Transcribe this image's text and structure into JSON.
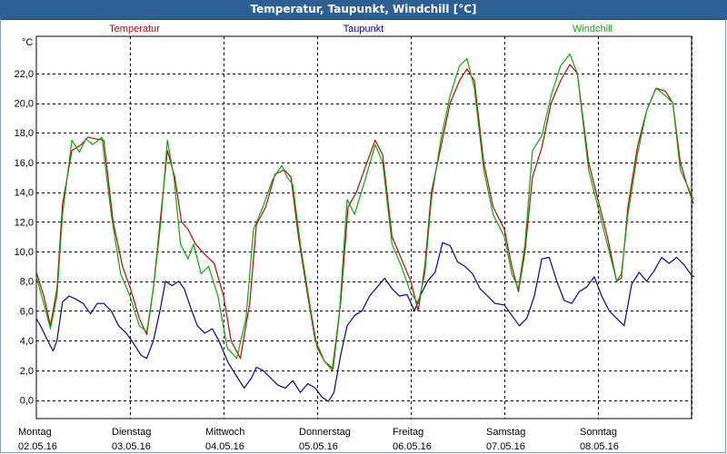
{
  "window": {
    "title": "Temperatur, Taupunkt, Windchill [°C]"
  },
  "chart_data": {
    "type": "line",
    "title": "Temperatur, Taupunkt, Windchill [°C]",
    "unit": "°C",
    "ylim": [
      -1.3,
      24.5
    ],
    "yticks": [
      "0,0",
      "2,0",
      "4,0",
      "6,0",
      "8,0",
      "10,0",
      "12,0",
      "14,0",
      "16,0",
      "18,0",
      "20,0",
      "22,0"
    ],
    "ytick_values": [
      0,
      2,
      4,
      6,
      8,
      10,
      12,
      14,
      16,
      18,
      20,
      22
    ],
    "xticks": [
      {
        "day": "Montag",
        "date": "02.05.16"
      },
      {
        "day": "Dienstag",
        "date": "03.05.16"
      },
      {
        "day": "Mittwoch",
        "date": "04.05.16"
      },
      {
        "day": "Donnerstag",
        "date": "05.05.16"
      },
      {
        "day": "Freitag",
        "date": "06.05.16"
      },
      {
        "day": "Samstag",
        "date": "07.05.16"
      },
      {
        "day": "Sonntag",
        "date": "08.05.16"
      }
    ],
    "x_range_days": [
      0,
      7.25
    ],
    "grid": true,
    "legend_position": "top",
    "series": [
      {
        "name": "Temperatur",
        "color": "#cc0000",
        "points": [
          [
            0.0,
            8.6
          ],
          [
            0.08,
            7.0
          ],
          [
            0.15,
            5.0
          ],
          [
            0.22,
            7.5
          ],
          [
            0.28,
            13.2
          ],
          [
            0.38,
            16.8
          ],
          [
            0.48,
            17.2
          ],
          [
            0.55,
            17.7
          ],
          [
            0.62,
            17.6
          ],
          [
            0.72,
            17.5
          ],
          [
            0.82,
            12.0
          ],
          [
            0.92,
            9.0
          ],
          [
            1.0,
            7.6
          ],
          [
            1.1,
            5.5
          ],
          [
            1.18,
            4.4
          ],
          [
            1.25,
            7.5
          ],
          [
            1.33,
            12.5
          ],
          [
            1.4,
            16.8
          ],
          [
            1.48,
            15.0
          ],
          [
            1.55,
            12.0
          ],
          [
            1.62,
            11.5
          ],
          [
            1.7,
            10.5
          ],
          [
            1.8,
            9.8
          ],
          [
            1.9,
            9.2
          ],
          [
            2.0,
            7.0
          ],
          [
            2.08,
            4.0
          ],
          [
            2.18,
            2.8
          ],
          [
            2.28,
            6.5
          ],
          [
            2.35,
            11.8
          ],
          [
            2.45,
            13.0
          ],
          [
            2.55,
            15.2
          ],
          [
            2.65,
            15.5
          ],
          [
            2.72,
            15.0
          ],
          [
            2.8,
            11.0
          ],
          [
            2.9,
            7.0
          ],
          [
            2.98,
            4.0
          ],
          [
            3.08,
            2.6
          ],
          [
            3.17,
            2.1
          ],
          [
            3.25,
            6.5
          ],
          [
            3.33,
            13.0
          ],
          [
            3.42,
            14.0
          ],
          [
            3.52,
            15.8
          ],
          [
            3.62,
            17.5
          ],
          [
            3.7,
            16.5
          ],
          [
            3.8,
            11.0
          ],
          [
            3.9,
            9.5
          ],
          [
            4.0,
            8.0
          ],
          [
            4.08,
            6.0
          ],
          [
            4.15,
            9.0
          ],
          [
            4.22,
            14.0
          ],
          [
            4.32,
            17.0
          ],
          [
            4.42,
            20.0
          ],
          [
            4.52,
            21.5
          ],
          [
            4.6,
            22.3
          ],
          [
            4.68,
            21.5
          ],
          [
            4.78,
            16.0
          ],
          [
            4.88,
            13.0
          ],
          [
            5.0,
            11.5
          ],
          [
            5.08,
            9.0
          ],
          [
            5.15,
            7.3
          ],
          [
            5.22,
            10.0
          ],
          [
            5.3,
            15.0
          ],
          [
            5.4,
            17.0
          ],
          [
            5.5,
            20.0
          ],
          [
            5.6,
            21.5
          ],
          [
            5.7,
            22.6
          ],
          [
            5.78,
            22.0
          ],
          [
            5.9,
            16.0
          ],
          [
            6.0,
            13.5
          ],
          [
            6.1,
            11.0
          ],
          [
            6.2,
            8.0
          ],
          [
            6.25,
            8.2
          ],
          [
            6.32,
            13.0
          ],
          [
            6.42,
            17.0
          ],
          [
            6.52,
            19.5
          ],
          [
            6.62,
            21.0
          ],
          [
            6.72,
            20.8
          ],
          [
            6.8,
            20.0
          ],
          [
            6.88,
            16.0
          ],
          [
            6.95,
            14.5
          ],
          [
            7.02,
            13.2
          ]
        ]
      },
      {
        "name": "Taupunkt",
        "color": "#0000b0",
        "points": [
          [
            0.0,
            5.5
          ],
          [
            0.06,
            4.8
          ],
          [
            0.12,
            4.0
          ],
          [
            0.18,
            3.3
          ],
          [
            0.22,
            4.0
          ],
          [
            0.28,
            6.6
          ],
          [
            0.35,
            7.0
          ],
          [
            0.42,
            6.8
          ],
          [
            0.5,
            6.5
          ],
          [
            0.58,
            5.8
          ],
          [
            0.65,
            6.5
          ],
          [
            0.72,
            6.5
          ],
          [
            0.8,
            6.0
          ],
          [
            0.88,
            5.0
          ],
          [
            0.96,
            4.5
          ],
          [
            1.04,
            3.8
          ],
          [
            1.12,
            3.0
          ],
          [
            1.18,
            2.8
          ],
          [
            1.25,
            4.0
          ],
          [
            1.32,
            6.0
          ],
          [
            1.38,
            8.0
          ],
          [
            1.45,
            7.7
          ],
          [
            1.52,
            8.0
          ],
          [
            1.58,
            7.5
          ],
          [
            1.65,
            6.2
          ],
          [
            1.72,
            5.0
          ],
          [
            1.8,
            4.5
          ],
          [
            1.88,
            4.8
          ],
          [
            1.95,
            4.0
          ],
          [
            2.05,
            2.5
          ],
          [
            2.15,
            1.5
          ],
          [
            2.22,
            0.8
          ],
          [
            2.3,
            1.5
          ],
          [
            2.35,
            2.2
          ],
          [
            2.42,
            2.0
          ],
          [
            2.5,
            1.5
          ],
          [
            2.58,
            1.0
          ],
          [
            2.66,
            0.8
          ],
          [
            2.74,
            1.3
          ],
          [
            2.82,
            0.5
          ],
          [
            2.9,
            1.1
          ],
          [
            2.98,
            0.8
          ],
          [
            3.05,
            0.2
          ],
          [
            3.12,
            -0.1
          ],
          [
            3.18,
            0.5
          ],
          [
            3.25,
            3.0
          ],
          [
            3.32,
            5.0
          ],
          [
            3.4,
            5.7
          ],
          [
            3.48,
            6.0
          ],
          [
            3.56,
            7.0
          ],
          [
            3.64,
            7.6
          ],
          [
            3.72,
            8.2
          ],
          [
            3.8,
            7.5
          ],
          [
            3.88,
            7.0
          ],
          [
            3.96,
            7.1
          ],
          [
            4.04,
            6.0
          ],
          [
            4.1,
            7.0
          ],
          [
            4.18,
            8.0
          ],
          [
            4.26,
            8.6
          ],
          [
            4.34,
            10.6
          ],
          [
            4.42,
            10.4
          ],
          [
            4.5,
            9.3
          ],
          [
            4.58,
            9.0
          ],
          [
            4.66,
            8.5
          ],
          [
            4.74,
            7.5
          ],
          [
            4.82,
            7.0
          ],
          [
            4.9,
            6.5
          ],
          [
            5.0,
            6.4
          ],
          [
            5.08,
            5.7
          ],
          [
            5.16,
            5.0
          ],
          [
            5.24,
            5.5
          ],
          [
            5.32,
            7.0
          ],
          [
            5.4,
            9.5
          ],
          [
            5.48,
            9.6
          ],
          [
            5.56,
            8.0
          ],
          [
            5.64,
            6.7
          ],
          [
            5.72,
            6.5
          ],
          [
            5.8,
            7.3
          ],
          [
            5.88,
            7.6
          ],
          [
            5.96,
            8.3
          ],
          [
            6.04,
            7.0
          ],
          [
            6.12,
            6.0
          ],
          [
            6.2,
            5.5
          ],
          [
            6.28,
            5.0
          ],
          [
            6.36,
            7.8
          ],
          [
            6.44,
            8.6
          ],
          [
            6.52,
            8.0
          ],
          [
            6.6,
            8.7
          ],
          [
            6.68,
            9.6
          ],
          [
            6.76,
            9.2
          ],
          [
            6.84,
            9.6
          ],
          [
            6.92,
            9.1
          ],
          [
            7.0,
            8.4
          ],
          [
            7.03,
            8.3
          ]
        ]
      },
      {
        "name": "Windchill",
        "color": "#00b000",
        "points": [
          [
            0.0,
            8.3
          ],
          [
            0.08,
            6.5
          ],
          [
            0.15,
            4.8
          ],
          [
            0.22,
            7.0
          ],
          [
            0.28,
            12.5
          ],
          [
            0.38,
            17.5
          ],
          [
            0.46,
            16.7
          ],
          [
            0.53,
            17.6
          ],
          [
            0.6,
            17.2
          ],
          [
            0.7,
            17.7
          ],
          [
            0.8,
            12.5
          ],
          [
            0.9,
            8.5
          ],
          [
            1.0,
            7.0
          ],
          [
            1.1,
            5.0
          ],
          [
            1.18,
            4.6
          ],
          [
            1.25,
            7.5
          ],
          [
            1.33,
            12.0
          ],
          [
            1.4,
            17.5
          ],
          [
            1.47,
            15.0
          ],
          [
            1.54,
            10.5
          ],
          [
            1.62,
            9.5
          ],
          [
            1.68,
            10.5
          ],
          [
            1.76,
            8.5
          ],
          [
            1.84,
            9.0
          ],
          [
            1.94,
            7.0
          ],
          [
            2.04,
            3.5
          ],
          [
            2.14,
            2.8
          ],
          [
            2.24,
            5.5
          ],
          [
            2.32,
            11.5
          ],
          [
            2.42,
            13.0
          ],
          [
            2.52,
            14.8
          ],
          [
            2.62,
            15.8
          ],
          [
            2.68,
            15.0
          ],
          [
            2.74,
            14.5
          ],
          [
            2.82,
            10.5
          ],
          [
            2.92,
            6.5
          ],
          [
            3.0,
            3.5
          ],
          [
            3.08,
            2.6
          ],
          [
            3.16,
            2.0
          ],
          [
            3.24,
            6.0
          ],
          [
            3.32,
            13.5
          ],
          [
            3.4,
            12.5
          ],
          [
            3.52,
            15.0
          ],
          [
            3.62,
            17.2
          ],
          [
            3.7,
            16.0
          ],
          [
            3.8,
            10.5
          ],
          [
            3.9,
            9.0
          ],
          [
            4.0,
            7.2
          ],
          [
            4.08,
            6.5
          ],
          [
            4.15,
            8.5
          ],
          [
            4.22,
            13.5
          ],
          [
            4.32,
            17.5
          ],
          [
            4.42,
            20.5
          ],
          [
            4.52,
            22.5
          ],
          [
            4.6,
            23.0
          ],
          [
            4.68,
            21.0
          ],
          [
            4.78,
            15.5
          ],
          [
            4.88,
            12.5
          ],
          [
            5.0,
            11.0
          ],
          [
            5.08,
            8.5
          ],
          [
            5.15,
            7.5
          ],
          [
            5.22,
            10.5
          ],
          [
            5.3,
            16.8
          ],
          [
            5.4,
            17.8
          ],
          [
            5.5,
            20.5
          ],
          [
            5.6,
            22.5
          ],
          [
            5.7,
            23.3
          ],
          [
            5.78,
            22.0
          ],
          [
            5.9,
            15.5
          ],
          [
            6.0,
            13.0
          ],
          [
            6.1,
            10.5
          ],
          [
            6.2,
            8.0
          ],
          [
            6.25,
            8.5
          ],
          [
            6.32,
            12.5
          ],
          [
            6.42,
            16.5
          ],
          [
            6.52,
            19.5
          ],
          [
            6.62,
            21.0
          ],
          [
            6.72,
            20.5
          ],
          [
            6.8,
            20.0
          ],
          [
            6.88,
            15.5
          ],
          [
            6.95,
            14.5
          ],
          [
            7.02,
            13.5
          ]
        ]
      }
    ]
  }
}
